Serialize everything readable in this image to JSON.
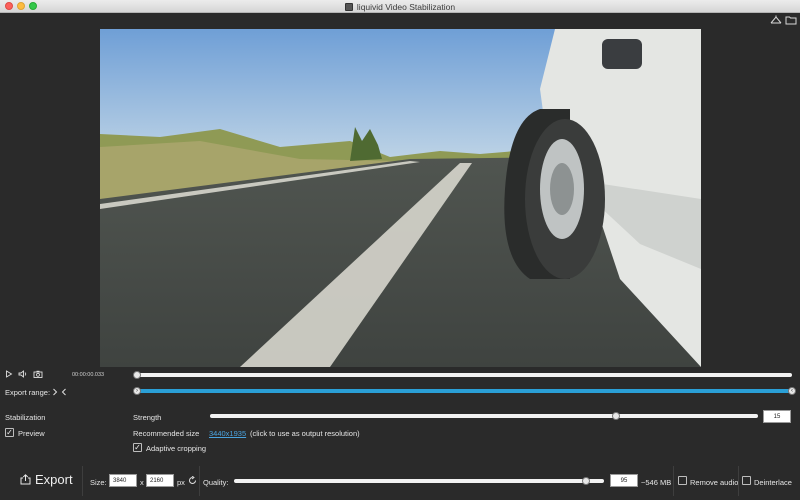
{
  "window": {
    "title": "liquivid Video Stabilization"
  },
  "icons": {
    "app": "app-icon",
    "crop_tool": "crop-icon",
    "folder": "folder-icon",
    "play": "play-icon",
    "volume": "speaker-icon",
    "snapshot": "camera-icon",
    "range_start": "chevron-right-icon",
    "range_end": "chevron-left-icon",
    "reset_size": "refresh-icon",
    "export": "export-icon"
  },
  "playback": {
    "timecode": "00:00:00.033",
    "position_fraction": 0.0
  },
  "export_range": {
    "label": "Export range:",
    "start_fraction": 0.0,
    "end_fraction": 1.0
  },
  "stabilization": {
    "section_label": "Stabilization",
    "preview_label": "Preview",
    "preview_checked": true,
    "strength_label": "Strength",
    "strength_value": "15",
    "strength_fraction": 0.74,
    "recommended_label": "Recommended size",
    "recommended_value": "3440x1935",
    "recommended_hint": "(click to use as output resolution)",
    "adaptive_label": "Adaptive cropping",
    "adaptive_checked": true
  },
  "export": {
    "button_label": "Export",
    "size_label": "Size:",
    "width": "3840",
    "times": "x",
    "height": "2160",
    "unit": "px",
    "quality_label": "Quality:",
    "quality_value": "95",
    "quality_fraction": 0.95,
    "estimated_size": "~546 MB",
    "remove_audio_label": "Remove audio",
    "remove_audio_checked": false,
    "deinterlace_label": "Deinterlace",
    "deinterlace_checked": false
  },
  "colors": {
    "accent": "#2a9fd6",
    "background": "#2a2a2a",
    "link": "#4aa3df"
  }
}
